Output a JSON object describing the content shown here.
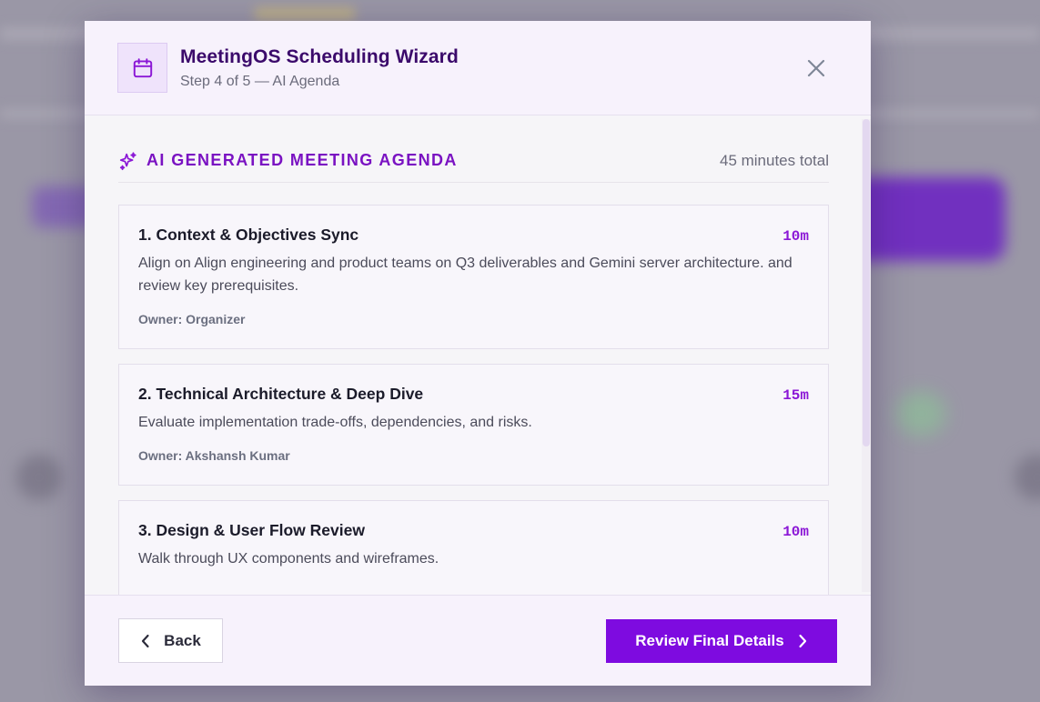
{
  "wizard": {
    "title": "MeetingOS Scheduling Wizard",
    "step": "Step 4 of 5 — AI Agenda",
    "header_icon": "calendar-icon",
    "close_icon": "close-icon"
  },
  "agenda": {
    "section_icon": "sparkles-icon",
    "section_title": "AI GENERATED MEETING AGENDA",
    "total": "45 minutes total",
    "items": [
      {
        "title": "1. Context & Objectives Sync",
        "duration": "10m",
        "description": "Align on Align engineering and product teams on Q3 deliverables and Gemini server architecture. and review key prerequisites.",
        "owner": "Owner: Organizer"
      },
      {
        "title": "2. Technical Architecture & Deep Dive",
        "duration": "15m",
        "description": "Evaluate implementation trade-offs, dependencies, and risks.",
        "owner": "Owner: Akshansh Kumar"
      },
      {
        "title": "3. Design & User Flow Review",
        "duration": "10m",
        "description": "Walk through UX components and wireframes.",
        "owner": ""
      }
    ]
  },
  "footer": {
    "back_label": "Back",
    "next_label": "Review Final Details"
  },
  "colors": {
    "accent": "#7e0be0",
    "title": "#3b0a6b",
    "duration": "#8b17d6"
  }
}
